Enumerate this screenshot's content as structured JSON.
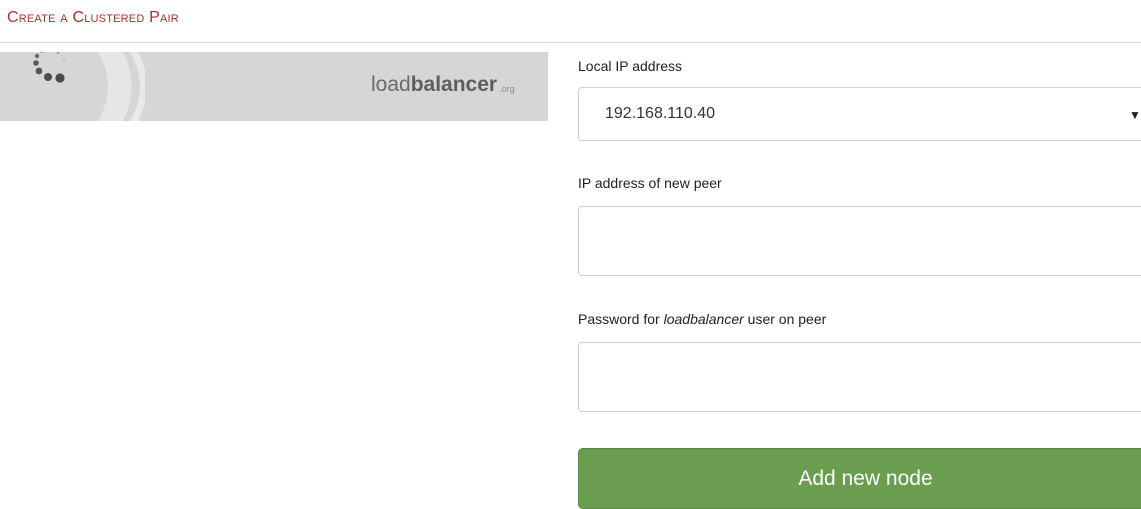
{
  "page": {
    "title": "Create a Clustered Pair"
  },
  "banner": {
    "logo_light": "load",
    "logo_bold": "balancer",
    "logo_suffix": ".org",
    "spinner_icon": "loading-spinner-icon"
  },
  "form": {
    "local_ip": {
      "label": "Local IP address",
      "selected": "192.168.110.40",
      "caret": "▼"
    },
    "peer_ip": {
      "label": "IP address of new peer",
      "value": "",
      "placeholder": ""
    },
    "password": {
      "label_prefix": "Password for ",
      "label_italic": "loadbalancer",
      "label_suffix": " user on peer",
      "value": "",
      "placeholder": ""
    },
    "submit_label": "Add new node"
  },
  "colors": {
    "title": "#a9332e",
    "banner_bg": "#d6d6d6",
    "button_bg": "#6a9d4f",
    "button_text": "#ffffff"
  }
}
